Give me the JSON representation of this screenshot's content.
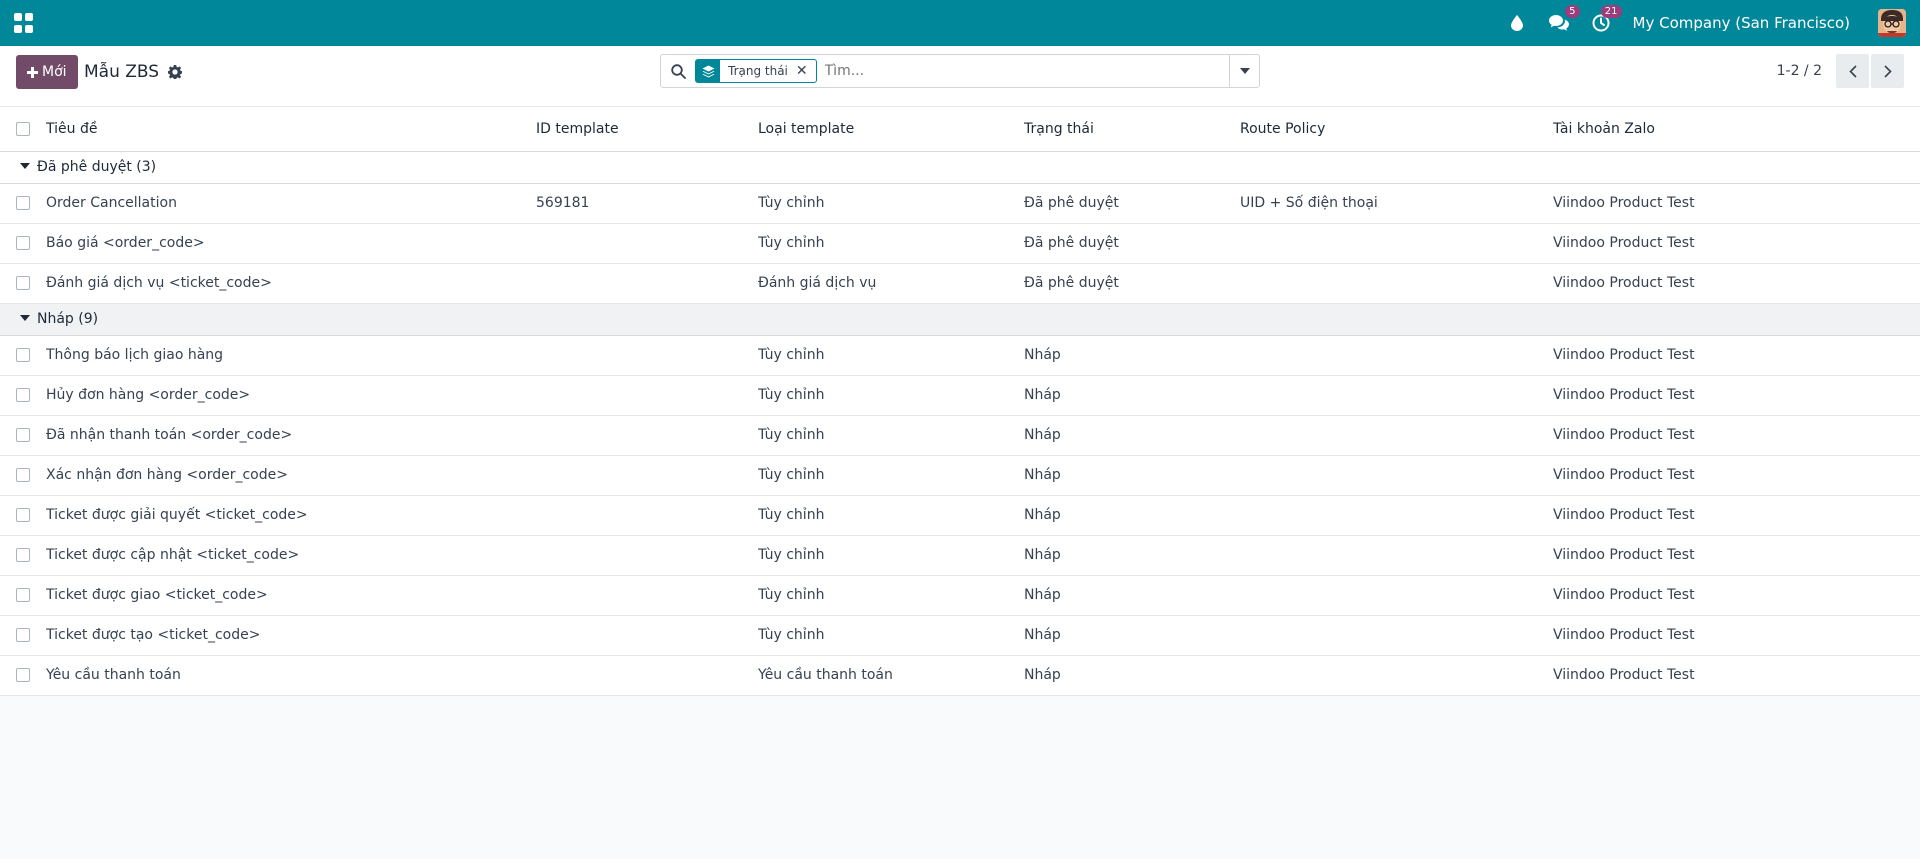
{
  "navbar": {
    "apps_icon": "apps-grid-icon",
    "icons": [
      {
        "name": "droplet-icon"
      },
      {
        "name": "chat-icon",
        "badge": "5"
      },
      {
        "name": "activity-clock-icon",
        "badge": "21"
      }
    ],
    "company": "My Company (San Francisco)",
    "accent": "#00879a"
  },
  "control": {
    "new_label": "Mới",
    "title": "Mẫu ZBS",
    "search": {
      "facet_label": "Trạng thái",
      "placeholder": "Tìm..."
    },
    "pager": "1-2 / 2"
  },
  "table": {
    "headers": [
      "Tiêu đề",
      "ID template",
      "Loại template",
      "Trạng thái",
      "Route Policy",
      "Tài khoản Zalo"
    ],
    "groups": [
      {
        "label": "Đã phê duyệt (3)",
        "rows": [
          [
            "Order Cancellation",
            "569181",
            "Tùy chỉnh",
            "Đã phê duyệt",
            "UID + Số điện thoại",
            "Viindoo Product Test"
          ],
          [
            "Báo giá <order_code>",
            "",
            "Tùy chỉnh",
            "Đã phê duyệt",
            "",
            "Viindoo Product Test"
          ],
          [
            "Đánh giá dịch vụ <ticket_code>",
            "",
            "Đánh giá dịch vụ",
            "Đã phê duyệt",
            "",
            "Viindoo Product Test"
          ]
        ]
      },
      {
        "label": "Nháp (9)",
        "rows": [
          [
            "Thông báo lịch giao hàng",
            "",
            "Tùy chỉnh",
            "Nháp",
            "",
            "Viindoo Product Test"
          ],
          [
            "Hủy đơn hàng <order_code>",
            "",
            "Tùy chỉnh",
            "Nháp",
            "",
            "Viindoo Product Test"
          ],
          [
            "Đã nhận thanh toán <order_code>",
            "",
            "Tùy chỉnh",
            "Nháp",
            "",
            "Viindoo Product Test"
          ],
          [
            "Xác nhận đơn hàng <order_code>",
            "",
            "Tùy chỉnh",
            "Nháp",
            "",
            "Viindoo Product Test"
          ],
          [
            "Ticket được giải quyết <ticket_code>",
            "",
            "Tùy chỉnh",
            "Nháp",
            "",
            "Viindoo Product Test"
          ],
          [
            "Ticket được cập nhật <ticket_code>",
            "",
            "Tùy chỉnh",
            "Nháp",
            "",
            "Viindoo Product Test"
          ],
          [
            "Ticket được giao <ticket_code>",
            "",
            "Tùy chỉnh",
            "Nháp",
            "",
            "Viindoo Product Test"
          ],
          [
            "Ticket được tạo <ticket_code>",
            "",
            "Tùy chỉnh",
            "Nháp",
            "",
            "Viindoo Product Test"
          ],
          [
            "Yêu cầu thanh toán",
            "",
            "Yêu cầu thanh toán",
            "Nháp",
            "",
            "Viindoo Product Test"
          ]
        ]
      }
    ]
  }
}
